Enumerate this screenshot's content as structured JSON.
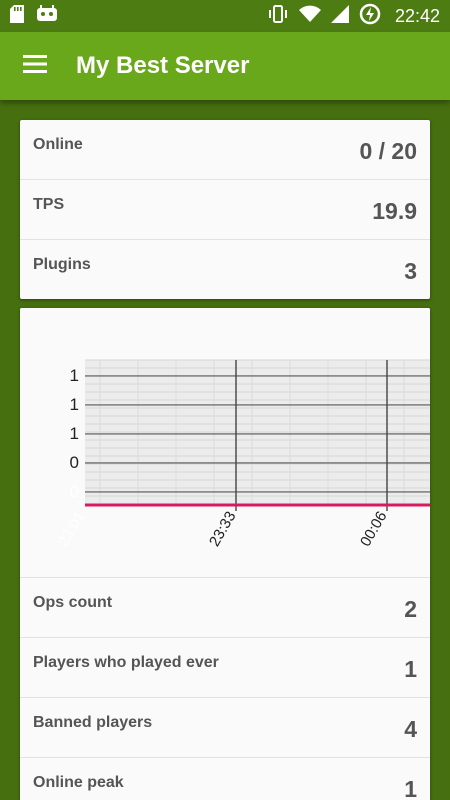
{
  "status_bar": {
    "time": "22:42",
    "icons": [
      "sd-card-icon",
      "android-debug-icon",
      "vibrate-icon",
      "wifi-icon",
      "signal-icon",
      "battery-charging-icon"
    ]
  },
  "app_bar": {
    "menu_icon": "hamburger-menu-icon",
    "title": "My Best Server"
  },
  "summary": [
    {
      "label": "Online",
      "value": "0 / 20"
    },
    {
      "label": "TPS",
      "value": "19.9"
    },
    {
      "label": "Plugins",
      "value": "3"
    }
  ],
  "chart_data": {
    "type": "line",
    "x_tick_labels": [
      "23:01",
      "23:33",
      "00:06"
    ],
    "y_tick_labels": [
      "1",
      "1",
      "1",
      "0",
      "0"
    ],
    "series": [
      {
        "color": "#d81b60",
        "x": [
          "23:01",
          "23:33",
          "00:06"
        ],
        "y": [
          0,
          0,
          0
        ]
      }
    ],
    "grid": true
  },
  "stats": [
    {
      "label": "Ops count",
      "value": "2"
    },
    {
      "label": "Players who played ever",
      "value": "1"
    },
    {
      "label": "Banned players",
      "value": "4"
    },
    {
      "label": "Online peak",
      "value": "1"
    }
  ]
}
